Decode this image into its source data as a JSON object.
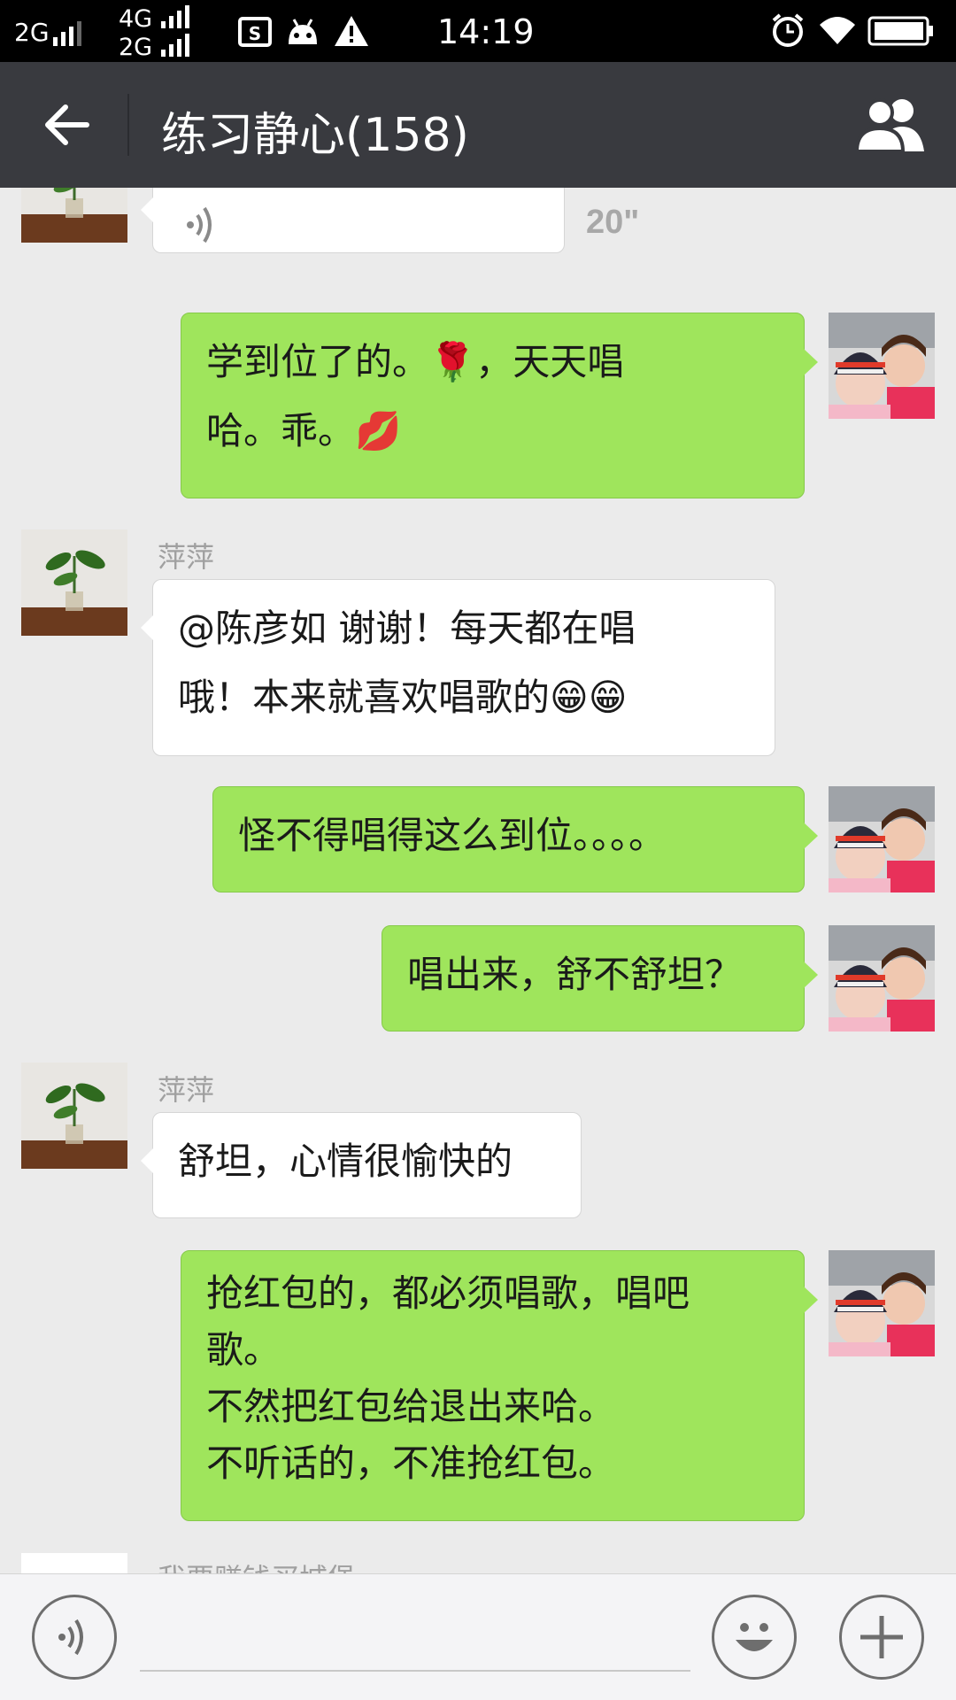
{
  "status_bar": {
    "network_1": "2G",
    "network_2_top": "4G",
    "network_2_bottom": "2G",
    "time": "14:19",
    "icons": [
      "sim-card-icon",
      "android-debug-icon",
      "warning-icon",
      "alarm-icon",
      "wifi-icon",
      "battery-icon"
    ]
  },
  "header": {
    "title": "练习静心(158)",
    "back_icon": "back-arrow-icon",
    "group_icon": "group-members-icon"
  },
  "messages": [
    {
      "side": "left",
      "sender": "",
      "type": "voice",
      "duration": "20\""
    },
    {
      "side": "right",
      "type": "text",
      "lines": [
        "学到位了的。🌹，天天唱",
        "哈。乖。💋"
      ]
    },
    {
      "side": "left",
      "sender": "萍萍",
      "type": "text",
      "lines": [
        "@陈彦如 谢谢！每天都在唱",
        "哦！本来就喜欢唱歌的😁😁"
      ]
    },
    {
      "side": "right",
      "type": "text",
      "lines": [
        "怪不得唱得这么到位。。。。"
      ]
    },
    {
      "side": "right",
      "type": "text",
      "lines": [
        "唱出来，舒不舒坦？"
      ]
    },
    {
      "side": "left",
      "sender": "萍萍",
      "type": "text",
      "lines": [
        "舒坦，心情很愉快的"
      ]
    },
    {
      "side": "right",
      "type": "text",
      "lines": [
        "抢红包的，都必须唱歌，唱吧",
        "歌。",
        "不然把红包给退出来哈。",
        "不听话的，不准抢红包。"
      ]
    },
    {
      "side": "left",
      "sender": "我要赚钱买城堡",
      "type": "partial"
    }
  ],
  "input_bar": {
    "voice_icon": "voice-input-icon",
    "emoji_icon": "emoji-icon",
    "plus_icon": "plus-icon",
    "placeholder": ""
  },
  "colors": {
    "status_bar": "#000000",
    "title_bar": "#393a3f",
    "chat_bg": "#ebebeb",
    "bubble_self": "#9fe55c",
    "bubble_other": "#ffffff"
  }
}
